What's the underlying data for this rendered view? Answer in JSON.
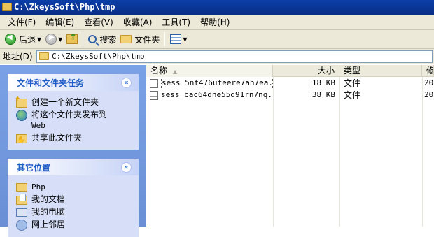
{
  "window": {
    "title": "C:\\ZkeysSoft\\Php\\tmp"
  },
  "menu": [
    "文件(F)",
    "编辑(E)",
    "查看(V)",
    "收藏(A)",
    "工具(T)",
    "帮助(H)"
  ],
  "toolbar": {
    "back_label": "后退",
    "search_label": "搜索",
    "folders_label": "文件夹",
    "icons": [
      "back-icon",
      "forward-icon",
      "up-folder-icon",
      "search-icon",
      "folder-icon",
      "views-icon"
    ]
  },
  "address": {
    "label": "地址(D)",
    "value": "C:\\ZkeysSoft\\Php\\tmp"
  },
  "tasks_panel": {
    "title": "文件和文件夹任务",
    "toggle": "«",
    "items": [
      {
        "label": "创建一个新文件夹",
        "icon": "new-folder-icon"
      },
      {
        "label": "将这个文件夹发布到",
        "sub": "Web",
        "icon": "globe-icon"
      },
      {
        "label": "共享此文件夹",
        "icon": "share-folder-icon"
      }
    ]
  },
  "places_panel": {
    "title": "其它位置",
    "toggle": "«",
    "items": [
      {
        "label": "Php",
        "icon": "folder-icon"
      },
      {
        "label": "我的文档",
        "icon": "my-documents-icon"
      },
      {
        "label": "我的电脑",
        "icon": "my-computer-icon"
      },
      {
        "label": "网上邻居",
        "icon": "network-icon"
      }
    ]
  },
  "columns": {
    "name": "名称",
    "size": "大小",
    "type": "类型",
    "date": "修"
  },
  "files": [
    {
      "name": "sess_5nt476ufeere7ah7ea...",
      "size": "18 KB",
      "type": "文件",
      "date": "20"
    },
    {
      "name": "sess_bac64dne55d91rn7nq...",
      "size": "38 KB",
      "type": "文件",
      "date": "20"
    }
  ]
}
